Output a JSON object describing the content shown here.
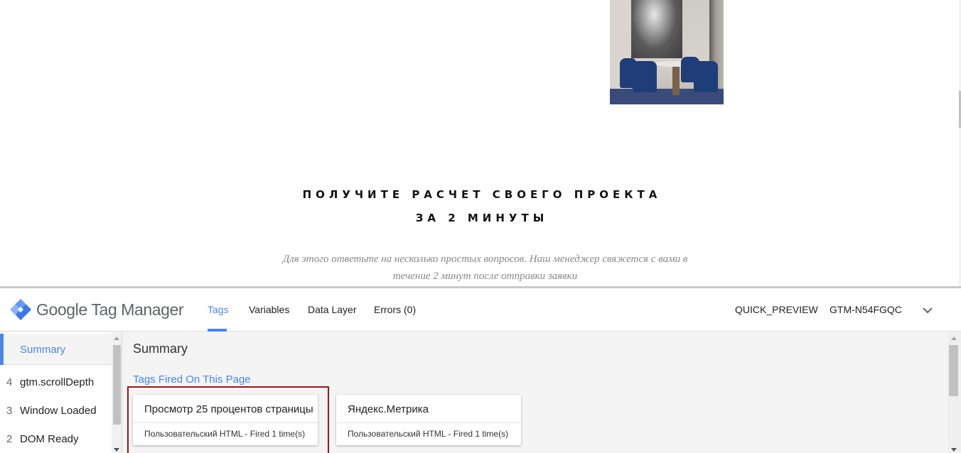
{
  "site": {
    "photo_alt": "dining room interior",
    "heading_line1": "ПОЛУЧИТЕ РАСЧЕТ СВОЕГО ПРОЕКТА",
    "heading_line2": "ЗА 2 МИНУТЫ",
    "subtext": "Для этого ответьте на несколько простых вопросов. Наш менеджер свяжется с вами в течение 2 минут после отправки заявки"
  },
  "gtm": {
    "brand": "Google Tag Manager",
    "tabs": [
      {
        "label": "Tags",
        "active": true
      },
      {
        "label": "Variables",
        "active": false
      },
      {
        "label": "Data Layer",
        "active": false
      },
      {
        "label": "Errors (0)",
        "active": false
      }
    ],
    "mode": "QUICK_PREVIEW",
    "container_id": "GTM-N54FGQC",
    "accent_color": "#4a86e8",
    "highlight_color": "#9a1515",
    "events": {
      "summary_label": "Summary",
      "items": [
        {
          "num": "4",
          "name": "gtm.scrollDepth"
        },
        {
          "num": "3",
          "name": "Window Loaded"
        },
        {
          "num": "2",
          "name": "DOM Ready"
        }
      ]
    },
    "main": {
      "title": "Summary",
      "section_title": "Tags Fired On This Page",
      "tags": [
        {
          "name": "Просмотр 25 процентов страницы",
          "meta": "Пользовательский HTML - Fired 1 time(s)",
          "highlighted": true
        },
        {
          "name": "Яндекс.Метрика",
          "meta": "Пользовательский HTML - Fired 1 time(s)",
          "highlighted": false
        }
      ]
    }
  }
}
